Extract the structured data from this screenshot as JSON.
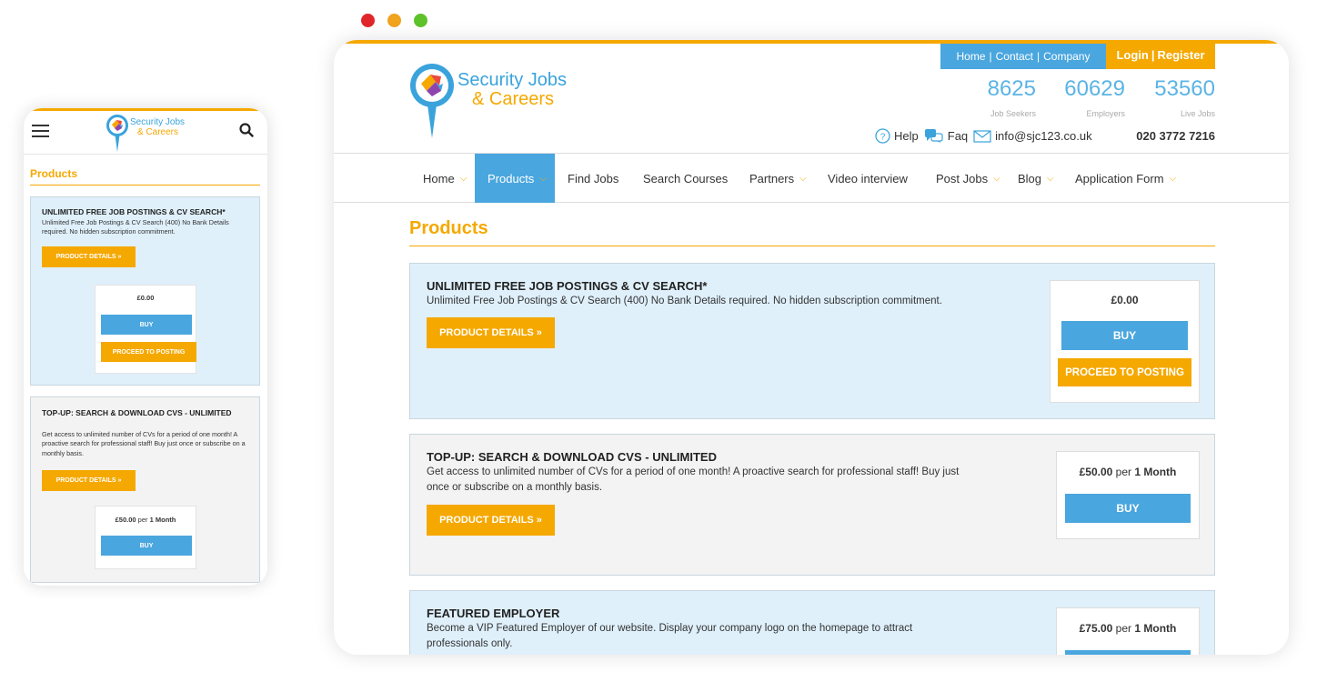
{
  "window_dots": [
    "#e0262a",
    "#f0a31c",
    "#5ec22b"
  ],
  "brand": {
    "line1": "Security Jobs",
    "line2": "& Careers"
  },
  "toplinks": {
    "home": "Home",
    "sep1": "|",
    "contact": "Contact",
    "sep2": "|",
    "company": "Company"
  },
  "auth": {
    "login": "Login",
    "sep": "|",
    "register": "Register"
  },
  "stats": [
    {
      "value": "8625",
      "label": "Job Seekers"
    },
    {
      "value": "60629",
      "label": "Employers"
    },
    {
      "value": "53560",
      "label": "Live Jobs"
    }
  ],
  "contact": {
    "help": "Help",
    "faq": "Faq",
    "email": "info@sjc123.co.uk",
    "phone": "020 3772 7216"
  },
  "nav": [
    {
      "label": "Home",
      "dropdown": true
    },
    {
      "label": "Products",
      "dropdown": true,
      "active": true
    },
    {
      "label": "Find Jobs",
      "dropdown": false
    },
    {
      "label": "Search Courses",
      "dropdown": false
    },
    {
      "label": "Partners",
      "dropdown": true
    },
    {
      "label": "Video interview",
      "dropdown": false
    },
    {
      "label": "Post Jobs",
      "dropdown": true
    },
    {
      "label": "Blog",
      "dropdown": true
    },
    {
      "label": "Application Form",
      "dropdown": true
    }
  ],
  "page_title": "Products",
  "products": [
    {
      "title": "UNLIMITED FREE JOB POSTINGS & CV SEARCH*",
      "desc": "Unlimited Free Job Postings & CV Search (400) No Bank Details required. No hidden subscription commitment.",
      "details_btn": "PRODUCT DETAILS »",
      "price": "£0.00",
      "buy": "BUY",
      "post": "PROCEED TO POSTING"
    },
    {
      "title": "TOP-UP: SEARCH & DOWNLOAD CVS - UNLIMITED",
      "desc": "Get access to unlimited number of CVs for a period of one month! A proactive search for professional staff! Buy just once or subscribe on a monthly basis.",
      "details_btn": "PRODUCT DETAILS »",
      "price": "£50.00",
      "per": "per",
      "period": "1 Month",
      "buy": "BUY"
    },
    {
      "title": "FEATURED EMPLOYER",
      "desc": "Become a VIP Featured Employer of our website. Display your company logo on the homepage to attract professionals only.",
      "price": "£75.00",
      "per": "per",
      "period": "1 Month"
    }
  ],
  "icons": {
    "menu": "hamburger-icon",
    "search": "search-icon",
    "help": "question-circle-icon",
    "faq": "chat-bubbles-icon",
    "email": "envelope-icon"
  }
}
